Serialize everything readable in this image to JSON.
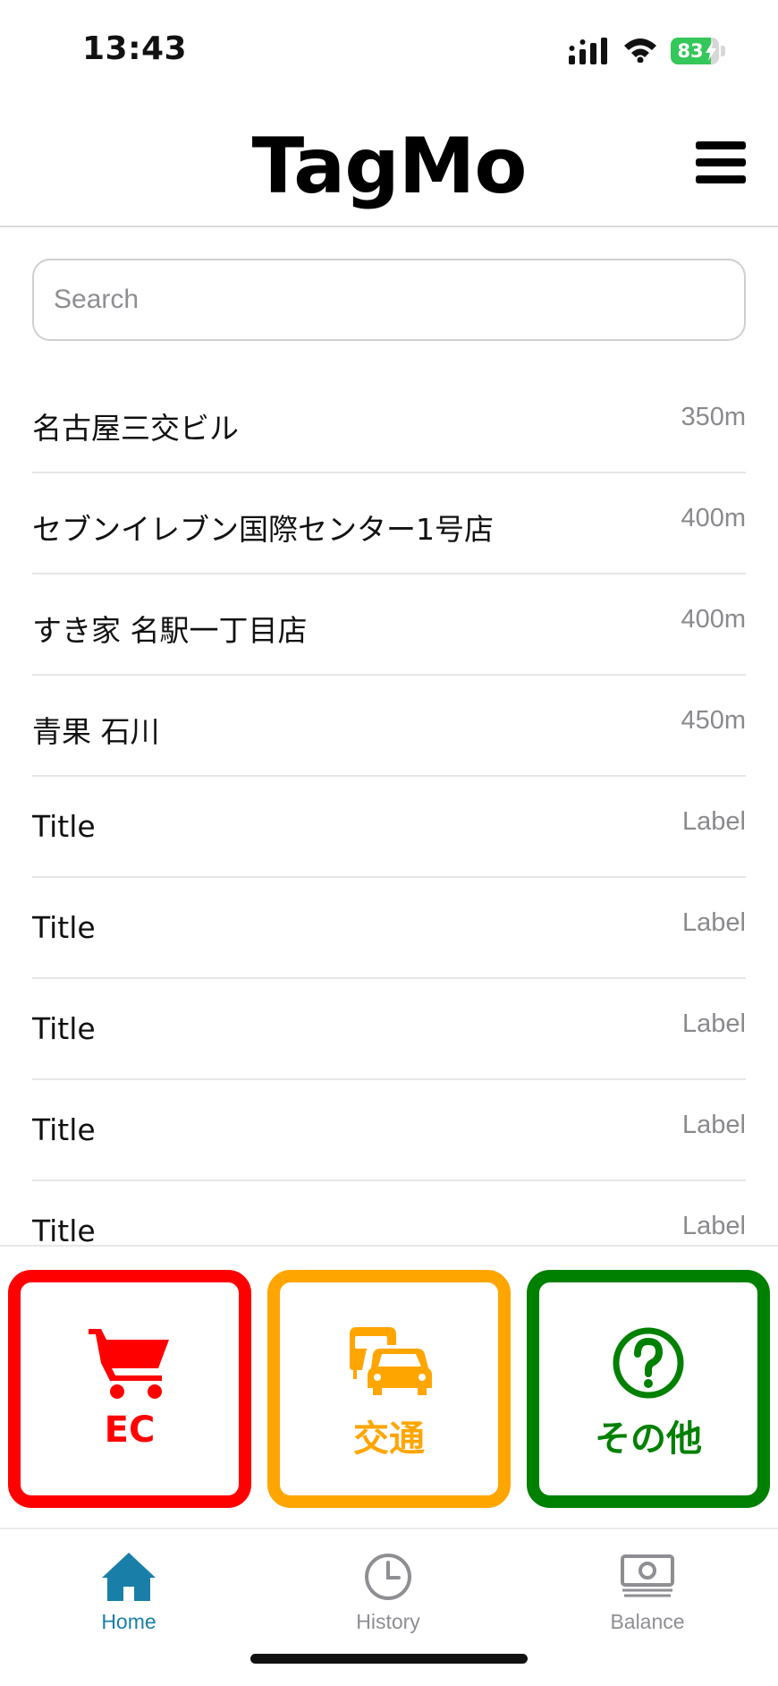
{
  "status_bar": {
    "time": "13:43",
    "battery_level": "83",
    "battery_fraction": 0.83,
    "battery_color": "#34c759",
    "icons": [
      "cellular-signal-icon",
      "wifi-icon",
      "battery-charging-icon"
    ]
  },
  "header": {
    "title": "TagMo",
    "menu_icon": "hamburger-menu-icon"
  },
  "search": {
    "placeholder": "Search",
    "value": ""
  },
  "list": {
    "items": [
      {
        "title": "名古屋三交ビル",
        "detail": "350m"
      },
      {
        "title": "セブンイレブン国際センター1号店",
        "detail": "400m"
      },
      {
        "title": "すき家 名駅一丁目店",
        "detail": "400m"
      },
      {
        "title": "青果 石川",
        "detail": "450m"
      },
      {
        "title": "Title",
        "detail": "Label"
      },
      {
        "title": "Title",
        "detail": "Label"
      },
      {
        "title": "Title",
        "detail": "Label"
      },
      {
        "title": "Title",
        "detail": "Label"
      },
      {
        "title": "Title",
        "detail": "Label"
      }
    ]
  },
  "categories": [
    {
      "label": "EC",
      "icon": "shopping-cart-icon",
      "color": "#ff0000"
    },
    {
      "label": "交通",
      "icon": "bus-car-icon",
      "color": "#ffa500"
    },
    {
      "label": "その他",
      "icon": "question-circle-icon",
      "color": "#008000"
    }
  ],
  "tab_bar": {
    "active_color": "#1a7fa8",
    "inactive_color": "#8e8e93",
    "tabs": [
      {
        "label": "Home",
        "icon": "house-icon",
        "active": true
      },
      {
        "label": "History",
        "icon": "clock-icon",
        "active": false
      },
      {
        "label": "Balance",
        "icon": "banknote-icon",
        "active": false
      }
    ]
  }
}
